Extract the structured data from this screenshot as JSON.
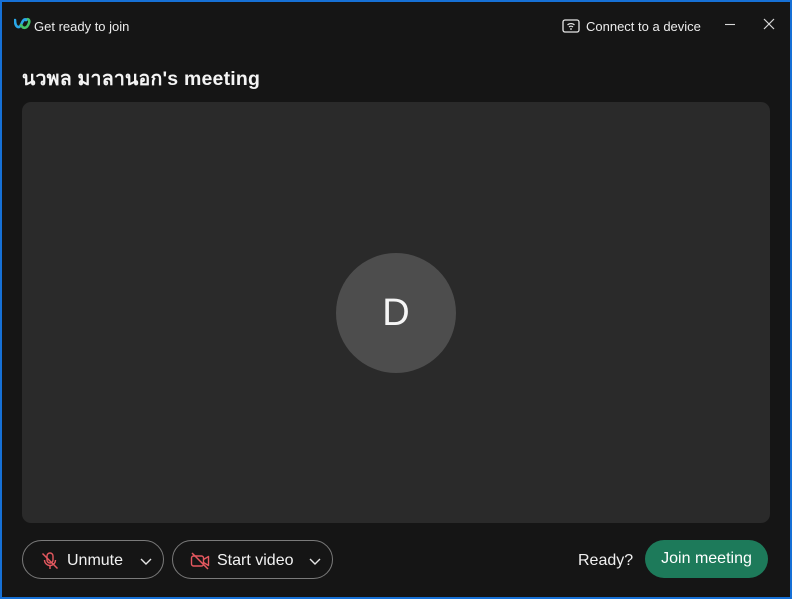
{
  "titlebar": {
    "app_icon": "webex-logo-icon",
    "title": "Get ready to join",
    "connect_device_label": "Connect to a device",
    "connect_device_icon": "cast-wifi-icon",
    "minimize_icon": "minimize-icon",
    "close_icon": "close-icon"
  },
  "meeting": {
    "title": "นวพล มาลานอก's meeting"
  },
  "preview": {
    "avatar_initial": "D"
  },
  "controls": {
    "unmute_label": "Unmute",
    "unmute_icon": "microphone-muted-icon",
    "video_label": "Start video",
    "video_icon": "video-off-icon",
    "ready_text": "Ready?",
    "join_label": "Join meeting"
  },
  "colors": {
    "window_border": "#1670d6",
    "background": "#151515",
    "preview_bg": "#2a2a2a",
    "avatar_bg": "#4d4d4d",
    "join_button": "#1d7a5a",
    "muted_icon": "#e5585f"
  }
}
